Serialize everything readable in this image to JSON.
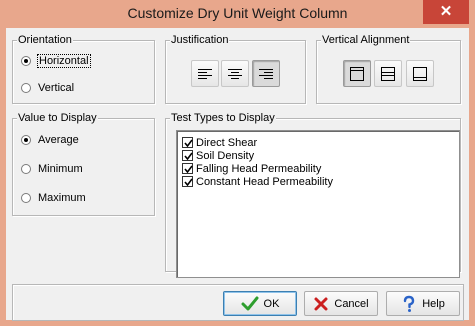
{
  "window": {
    "title": "Customize Dry Unit Weight Column",
    "close_glyph": "✕"
  },
  "orientation": {
    "legend": "Orientation",
    "options": [
      {
        "label": "Horizontal",
        "selected": true,
        "focused": true
      },
      {
        "label": "Vertical",
        "selected": false
      }
    ]
  },
  "justification": {
    "legend": "Justification",
    "buttons": [
      {
        "icon": "align-left-icon",
        "pressed": false
      },
      {
        "icon": "align-center-icon",
        "pressed": false
      },
      {
        "icon": "align-right-icon",
        "pressed": true
      }
    ]
  },
  "vertical_alignment": {
    "legend": "Vertical Alignment",
    "buttons": [
      {
        "icon": "align-top-icon",
        "pressed": true
      },
      {
        "icon": "align-middle-icon",
        "pressed": false
      },
      {
        "icon": "align-bottom-icon",
        "pressed": false
      }
    ]
  },
  "value_to_display": {
    "legend": "Value to Display",
    "options": [
      {
        "label": "Average",
        "selected": true
      },
      {
        "label": "Minimum",
        "selected": false
      },
      {
        "label": "Maximum",
        "selected": false
      }
    ]
  },
  "test_types": {
    "legend": "Test Types to Display",
    "items": [
      {
        "label": "Direct Shear",
        "checked": true
      },
      {
        "label": "Soil Density",
        "checked": true
      },
      {
        "label": "Falling Head Permeability",
        "checked": true
      },
      {
        "label": "Constant Head Permeability",
        "checked": true
      }
    ]
  },
  "buttons": {
    "ok": {
      "label": "OK",
      "icon": "checkmark-icon"
    },
    "cancel": {
      "label": "Cancel",
      "icon": "x-icon"
    },
    "help": {
      "label": "Help",
      "icon": "help-question-icon"
    }
  },
  "colors": {
    "title_bar": "#e8a78c",
    "close_button": "#c84538",
    "dialog_bg": "#f0f0f0",
    "ok_green": "#2e9e2e",
    "cancel_red": "#cc2020",
    "help_blue": "#2a63c8"
  }
}
